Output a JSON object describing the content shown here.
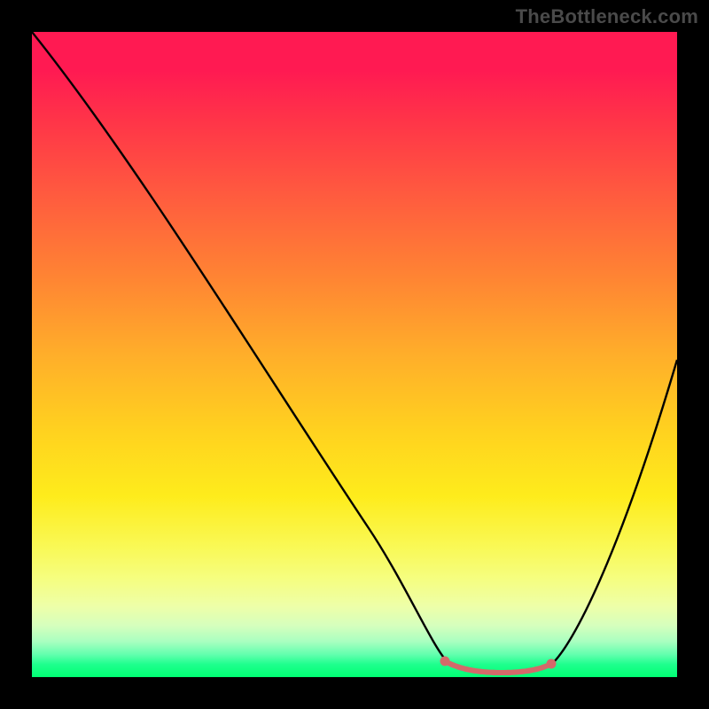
{
  "watermark": "TheBottleneck.com",
  "chart_data": {
    "type": "line",
    "title": "",
    "xlabel": "",
    "ylabel": "",
    "xlim": [
      0,
      100
    ],
    "ylim": [
      0,
      100
    ],
    "series": [
      {
        "name": "bottleneck-curve",
        "x": [
          0,
          6,
          12,
          18,
          24,
          30,
          36,
          42,
          48,
          54,
          60,
          63,
          66,
          70,
          74,
          78,
          80,
          84,
          88,
          92,
          96,
          100
        ],
        "y": [
          100,
          92,
          84,
          76,
          68,
          60,
          52,
          44,
          36,
          28,
          18,
          10,
          4,
          1,
          0,
          0,
          1,
          6,
          14,
          24,
          36,
          50
        ]
      }
    ],
    "flat_region": {
      "x_start": 63,
      "x_end": 80
    },
    "markers": [
      {
        "name": "flat-left-dot",
        "x": 63,
        "y": 3
      },
      {
        "name": "flat-right-dot",
        "x": 80,
        "y": 3
      }
    ],
    "colors": {
      "gradient_top": "#ff1a52",
      "gradient_mid": "#ffd21f",
      "gradient_bottom": "#00ff73",
      "curve": "#000000",
      "flat_segment": "#d46a6a",
      "marker": "#d46a6a"
    }
  }
}
